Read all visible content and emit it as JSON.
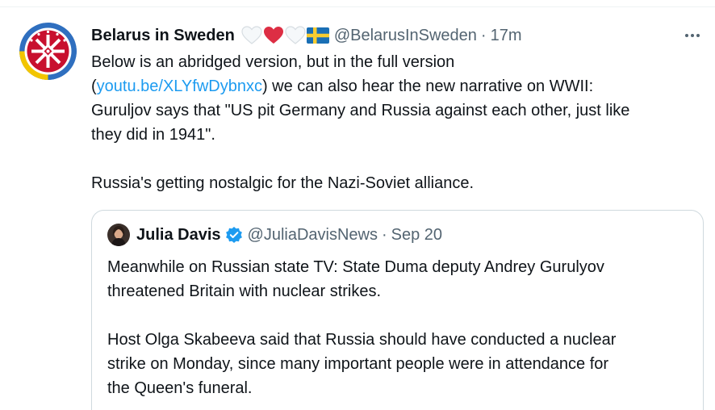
{
  "tweet": {
    "author": {
      "display_name": "Belarus in Sweden",
      "handle": "@BelarusInSweden",
      "time": "17m",
      "name_emojis": [
        "white-heart-icon",
        "red-heart-icon",
        "white-heart-icon",
        "sweden-flag-icon"
      ]
    },
    "more_icon": "more-dots-icon",
    "body": {
      "line1": "Below is an abridged version, but in the full version",
      "line2_prefix": "(",
      "link": "youtu.be/XLYfwDybnxc",
      "line2_suffix": ") we can also hear the new narrative on WWII:",
      "line3": "Guruljov says that \"US pit Germany and Russia against each other, just like",
      "line4": "they did in 1941\".",
      "line5": "Russia's getting nostalgic for the Nazi-Soviet alliance."
    },
    "dot": "·"
  },
  "quoted_tweet": {
    "display_name": "Julia Davis",
    "handle": "@JuliaDavisNews",
    "time": "Sep 20",
    "verified_icon": "verified-badge-icon",
    "body": {
      "line1": "Meanwhile on Russian state TV: State Duma deputy Andrey Gurulyov",
      "line2": "threatened Britain with nuclear strikes.",
      "line3": "Host Olga Skabeeva said that Russia should have conducted a nuclear",
      "line4": "strike on Monday, since many important people were in attendance for",
      "line5": "the Queen's funeral."
    }
  },
  "colors": {
    "link": "#1d9bf0",
    "secondary_text": "#536471",
    "border": "#cfd9de",
    "avatar_red": "#c8102e",
    "avatar_ring_blue": "#2f6fbf",
    "avatar_ring_yellow": "#f2c500"
  }
}
